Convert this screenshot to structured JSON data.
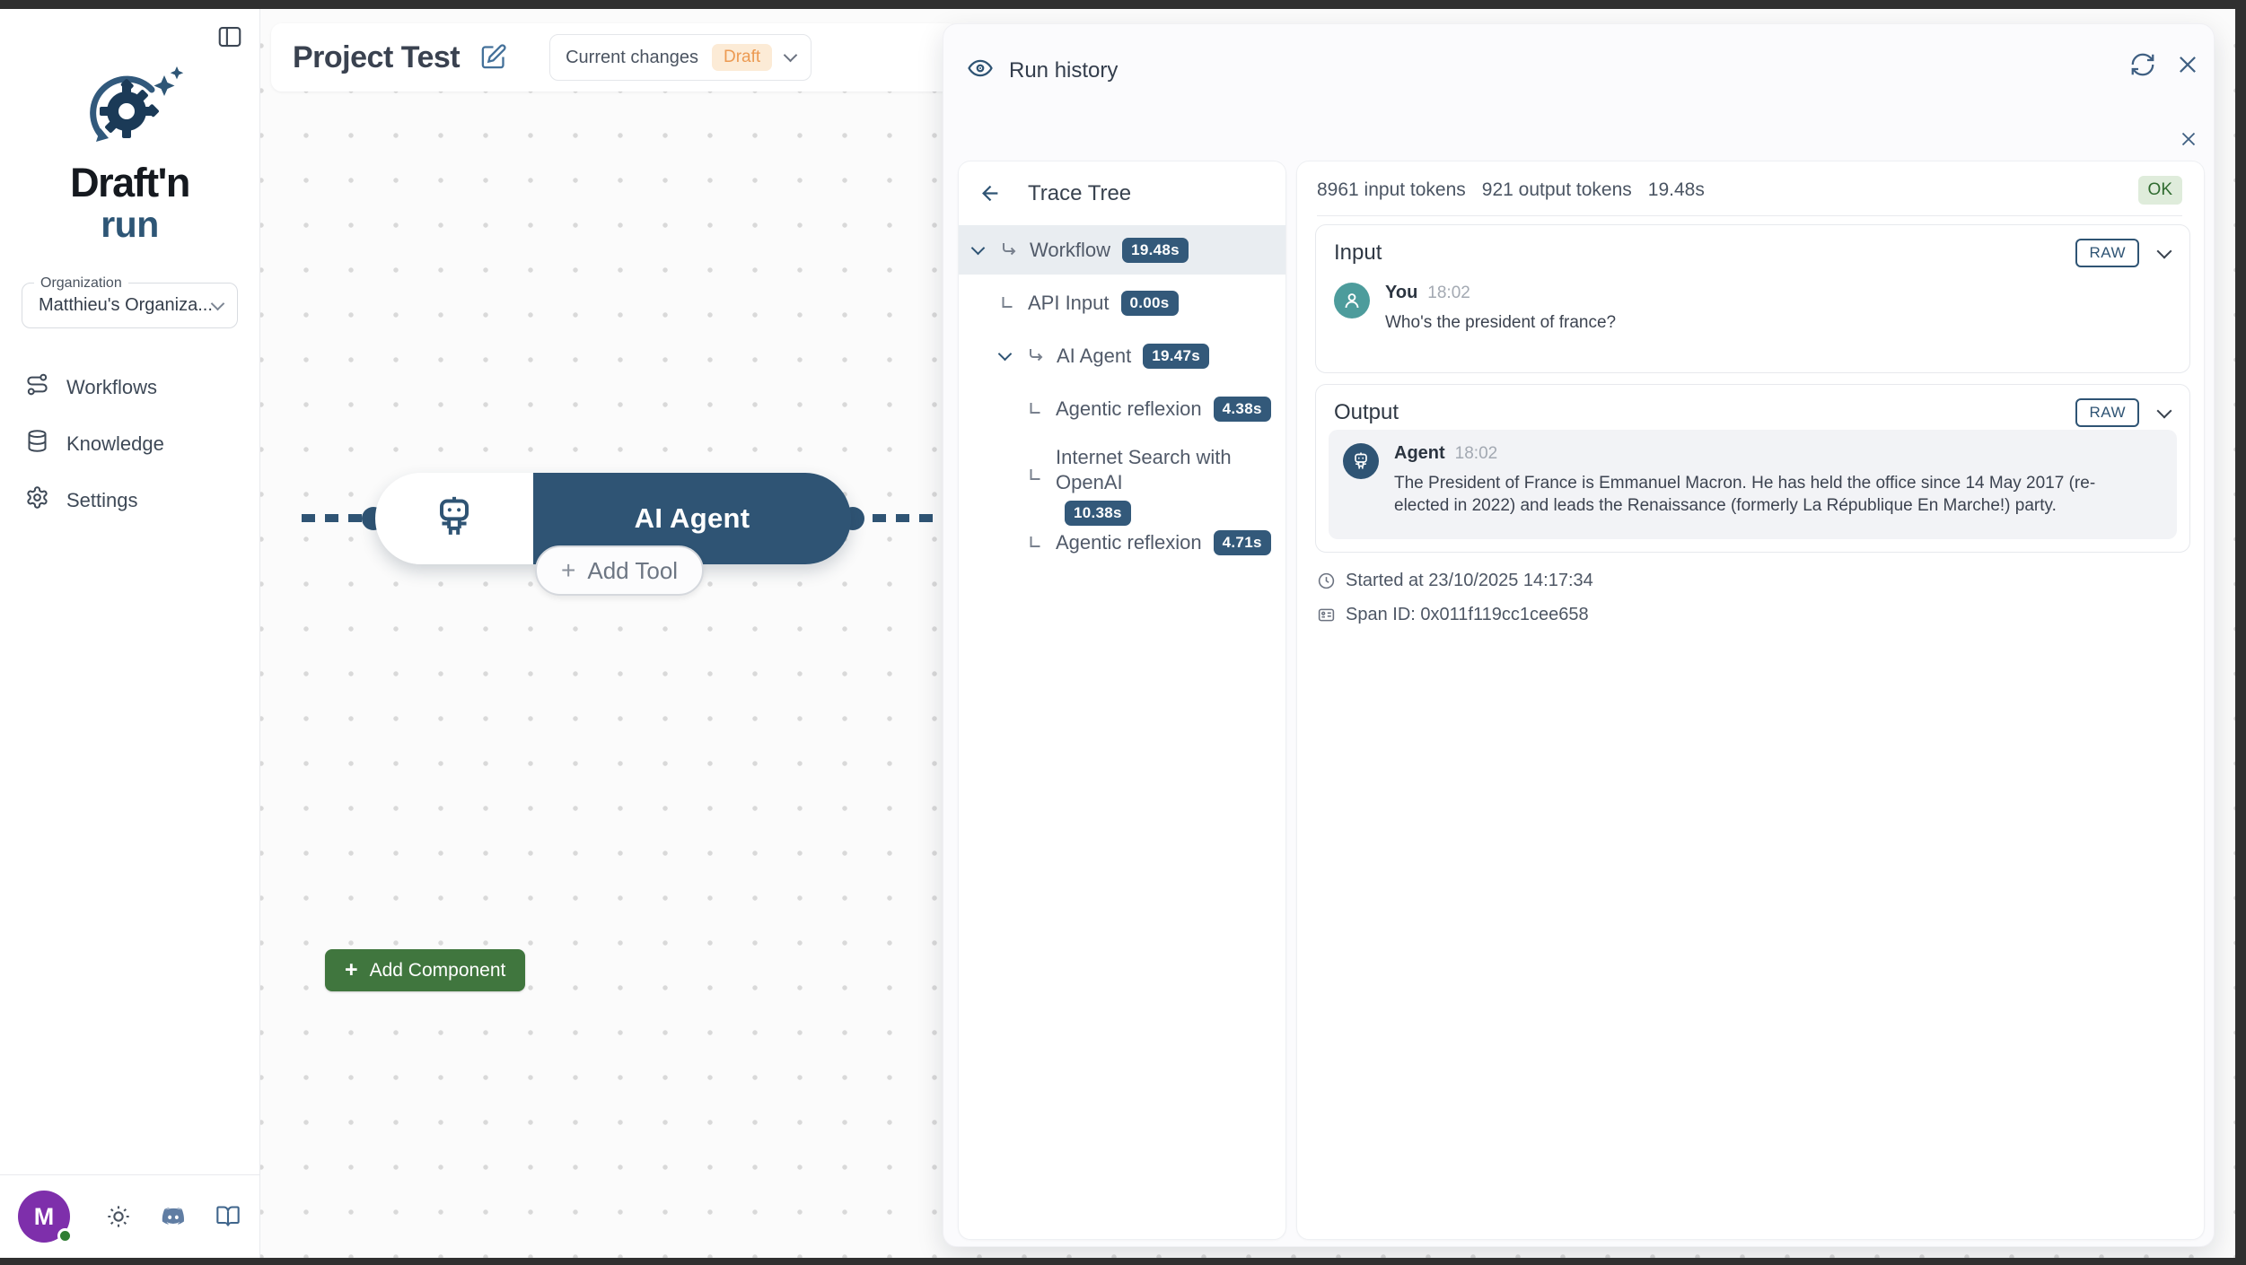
{
  "colors": {
    "primary_blue": "#2F5474",
    "badge_blue": "#33597a",
    "green_button": "#40763E",
    "ok_badge_bg": "#dfecdb",
    "ok_badge_text": "#2f6b2f",
    "draft_badge_bg": "#fcebd6",
    "draft_badge_text": "#ec9a52",
    "avatar_purple": "#7e2fab",
    "avatar_teal": "#4d9c9c",
    "selected_row_bg": "#e9edf1"
  },
  "icons": {
    "plus": "+"
  },
  "sidebar": {
    "logo": {
      "line1": "Draft'n",
      "line2": "run"
    },
    "organization": {
      "label": "Organization",
      "value": "Matthieu's Organiza..."
    },
    "nav": [
      {
        "label": "Workflows"
      },
      {
        "label": "Knowledge"
      },
      {
        "label": "Settings"
      }
    ],
    "footer": {
      "avatar_initial": "M"
    }
  },
  "canvas": {
    "header": {
      "title": "Project Test",
      "version_label": "Current changes",
      "version_badge": "Draft"
    },
    "node": {
      "label": "AI Agent",
      "add_tool_label": "Add Tool"
    },
    "add_component_label": "Add Component"
  },
  "panel": {
    "title": "Run history",
    "trace": {
      "title": "Trace Tree",
      "rows": [
        {
          "label": "Workflow",
          "duration": "19.48s"
        },
        {
          "label": "API Input",
          "duration": "0.00s"
        },
        {
          "label": "AI Agent",
          "duration": "19.47s"
        },
        {
          "label": "Agentic reflexion",
          "duration": "4.38s"
        },
        {
          "label": "Internet Search with OpenAI",
          "duration": "10.38s"
        },
        {
          "label": "Agentic reflexion",
          "duration": "4.71s"
        }
      ]
    },
    "detail": {
      "input_tokens": "8961 input tokens",
      "output_tokens": "921 output tokens",
      "duration": "19.48s",
      "status": "OK",
      "input": {
        "heading": "Input",
        "raw_label": "RAW",
        "sender": "You",
        "time": "18:02",
        "message": "Who's the president of france?"
      },
      "output": {
        "heading": "Output",
        "raw_label": "RAW",
        "sender": "Agent",
        "time": "18:02",
        "message": "The President of France is Emmanuel Macron. He has held the office since 14 May 2017 (re-elected in 2022) and leads the Renaissance (formerly La République En Marche!) party."
      },
      "started_at": "Started at 23/10/2025 14:17:34",
      "span_id": "Span ID: 0x011f119cc1cee658"
    }
  }
}
